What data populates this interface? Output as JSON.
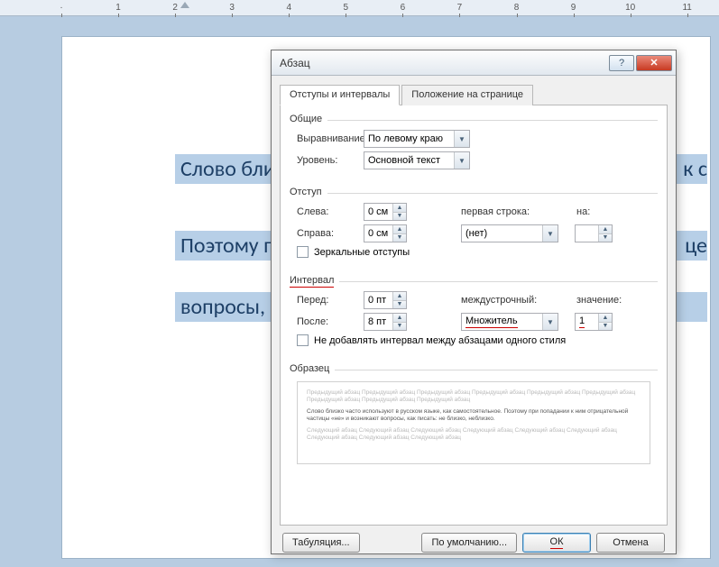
{
  "ruler": {
    "marks": [
      "1",
      "2",
      "3",
      "4",
      "5",
      "6",
      "7",
      "8",
      "9",
      "10",
      "11"
    ]
  },
  "page": {
    "line1": "Слово бли",
    "line1_right": "к с",
    "line2": "Поэтому п",
    "line2_right": "це",
    "line3": "вопросы, "
  },
  "dialog": {
    "title": "Абзац",
    "tabs": {
      "indent": "Отступы и интервалы",
      "position": "Положение на странице"
    },
    "common": {
      "legend": "Общие",
      "align_label": "Выравнивание:",
      "align_value": "По левому краю",
      "level_label": "Уровень:",
      "level_value": "Основной текст"
    },
    "indent": {
      "legend": "Отступ",
      "left_label": "Слева:",
      "left_value": "0 см",
      "right_label": "Справа:",
      "right_value": "0 см",
      "first_label": "первая строка:",
      "first_value": "(нет)",
      "on_label": "на:",
      "on_value": "",
      "mirror": "Зеркальные отступы"
    },
    "interval": {
      "legend": "Интервал",
      "before_label": "Перед:",
      "before_value": "0 пт",
      "after_label": "После:",
      "after_value": "8 пт",
      "line_label": "междустрочный:",
      "line_value": "Множитель",
      "val_label": "значение:",
      "val_value": "1",
      "nospace": "Не добавлять интервал между абзацами одного стиля"
    },
    "preview": {
      "legend": "Образец",
      "grey1": "Предыдущий абзац Предыдущий абзац Предыдущий абзац Предыдущий абзац Предыдущий абзац Предыдущий абзац Предыдущий абзац Предыдущий абзац Предыдущий абзац",
      "bold": "Слово близко часто используют в русском языке, как самостоятельное. Поэтому при попадании к ним отрицательной частицы «не» и возникают вопросы, как писать: не близко, неблизко.",
      "grey2": "Следующий абзац Следующий абзац Следующий абзац Следующий абзац Следующий абзац Следующий абзац Следующий абзац Следующий абзац Следующий абзац"
    },
    "buttons": {
      "tabs": "Табуляция...",
      "default": "По умолчанию...",
      "ok": "ОК",
      "cancel": "Отмена"
    }
  }
}
